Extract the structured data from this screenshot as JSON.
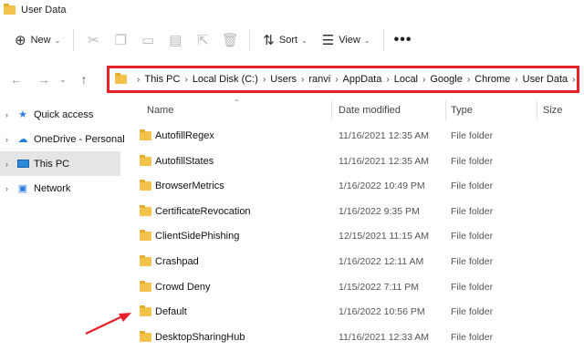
{
  "window": {
    "title": "User Data"
  },
  "toolbar": {
    "new_label": "New",
    "sort_label": "Sort",
    "view_label": "View",
    "more_label": "•••"
  },
  "address": {
    "crumbs": [
      "This PC",
      "Local Disk (C:)",
      "Users",
      "ranvi",
      "AppData",
      "Local",
      "Google",
      "Chrome",
      "User Data"
    ]
  },
  "sidebar": {
    "items": [
      {
        "label": "Quick access"
      },
      {
        "label": "OneDrive - Personal"
      },
      {
        "label": "This PC"
      },
      {
        "label": "Network"
      }
    ]
  },
  "columns": {
    "name": "Name",
    "date": "Date modified",
    "type": "Type",
    "size": "Size"
  },
  "files": [
    {
      "name": "AutofillRegex",
      "date": "11/16/2021 12:35 AM",
      "type": "File folder"
    },
    {
      "name": "AutofillStates",
      "date": "11/16/2021 12:35 AM",
      "type": "File folder"
    },
    {
      "name": "BrowserMetrics",
      "date": "1/16/2022 10:49 PM",
      "type": "File folder"
    },
    {
      "name": "CertificateRevocation",
      "date": "1/16/2022 9:35 PM",
      "type": "File folder"
    },
    {
      "name": "ClientSidePhishing",
      "date": "12/15/2021 11:15 AM",
      "type": "File folder"
    },
    {
      "name": "Crashpad",
      "date": "1/16/2022 12:11 AM",
      "type": "File folder"
    },
    {
      "name": "Crowd Deny",
      "date": "1/15/2022 7:11 PM",
      "type": "File folder"
    },
    {
      "name": "Default",
      "date": "1/16/2022 10:56 PM",
      "type": "File folder"
    },
    {
      "name": "DesktopSharingHub",
      "date": "11/16/2021 12:33 AM",
      "type": "File folder"
    }
  ],
  "colors": {
    "highlight_box": "#e8202a",
    "folder": "#f3c24a",
    "selected_bg": "#e5e5e5"
  }
}
